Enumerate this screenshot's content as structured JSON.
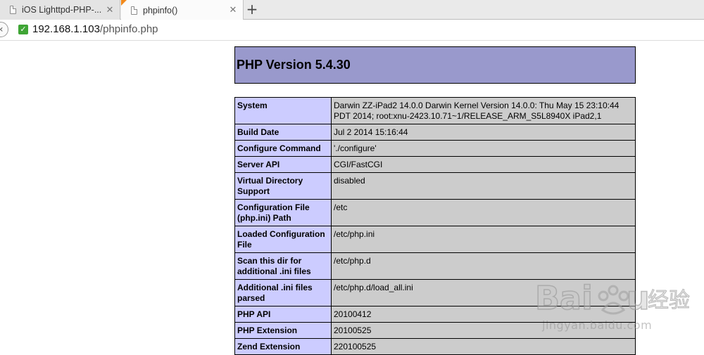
{
  "browser": {
    "tabs": [
      {
        "title": "iOS Lighttpd-PHP-...",
        "active": false
      },
      {
        "title": "phpinfo()",
        "active": true
      }
    ],
    "new_tab_label": "+",
    "close_label": "✕",
    "url": {
      "host": "192.168.1.103",
      "path": "/phpinfo.php"
    },
    "accent_color": "#f28a1c",
    "secure_color": "#3fa535"
  },
  "page": {
    "heading": "PHP Version 5.4.30",
    "header_bg": "#9999cc",
    "key_bg": "#ccccff",
    "value_bg": "#cccccc",
    "rows": [
      {
        "key": "System",
        "value": "Darwin ZZ-iPad2 14.0.0 Darwin Kernel Version 14.0.0: Thu May 15 23:10:44 PDT 2014; root:xnu-2423.10.71~1/RELEASE_ARM_S5L8940X iPad2,1"
      },
      {
        "key": "Build Date",
        "value": "Jul 2 2014 15:16:44"
      },
      {
        "key": "Configure Command",
        "value": "'./configure'"
      },
      {
        "key": "Server API",
        "value": "CGI/FastCGI"
      },
      {
        "key": "Virtual Directory Support",
        "value": "disabled"
      },
      {
        "key": "Configuration File (php.ini) Path",
        "value": "/etc"
      },
      {
        "key": "Loaded Configuration File",
        "value": "/etc/php.ini"
      },
      {
        "key": "Scan this dir for additional .ini files",
        "value": "/etc/php.d"
      },
      {
        "key": "Additional .ini files parsed",
        "value": "/etc/php.d/load_all.ini"
      },
      {
        "key": "PHP API",
        "value": "20100412"
      },
      {
        "key": "PHP Extension",
        "value": "20100525"
      },
      {
        "key": "Zend Extension",
        "value": "220100525"
      }
    ]
  },
  "watermark": {
    "logo_text": "Baidu 经验",
    "sub_text": "jingyan.baidu.com"
  }
}
